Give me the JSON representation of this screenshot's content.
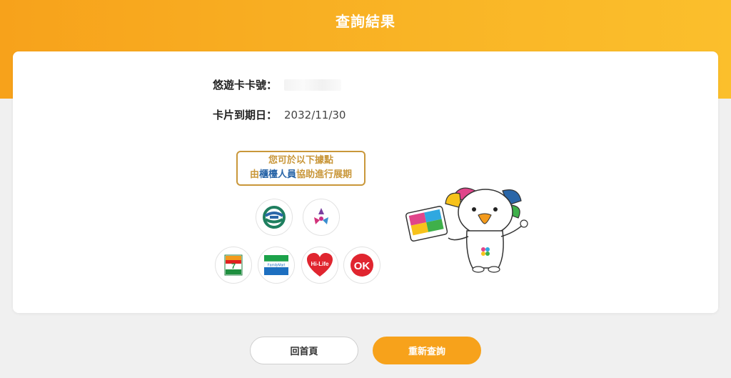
{
  "header": {
    "title": "查詢結果"
  },
  "card_info": {
    "card_number_label": "悠遊卡卡號：",
    "expiry_label": "卡片到期日：",
    "expiry_value": "2032/11/30"
  },
  "notice": {
    "line1": "您可於以下據點",
    "line2_prefix": "由",
    "line2_highlight": "櫃檯人員",
    "line2_suffix": "協助進行展期"
  },
  "logos": [
    {
      "name": "taipei-metro-logo"
    },
    {
      "name": "new-taipei-metro-logo"
    },
    {
      "name": "seven-eleven-logo",
      "text": "7-ELEVEn"
    },
    {
      "name": "familymart-logo",
      "text": "FamilyMart"
    },
    {
      "name": "hilife-logo",
      "text": "Hi-Life"
    },
    {
      "name": "ok-mart-logo",
      "text": "OK"
    }
  ],
  "buttons": {
    "home_label": "回首頁",
    "requery_label": "重新查詢"
  },
  "colors": {
    "brand_orange": "#f7a21b",
    "notice_gold": "#c9973a",
    "notice_blue": "#2a66a8"
  }
}
